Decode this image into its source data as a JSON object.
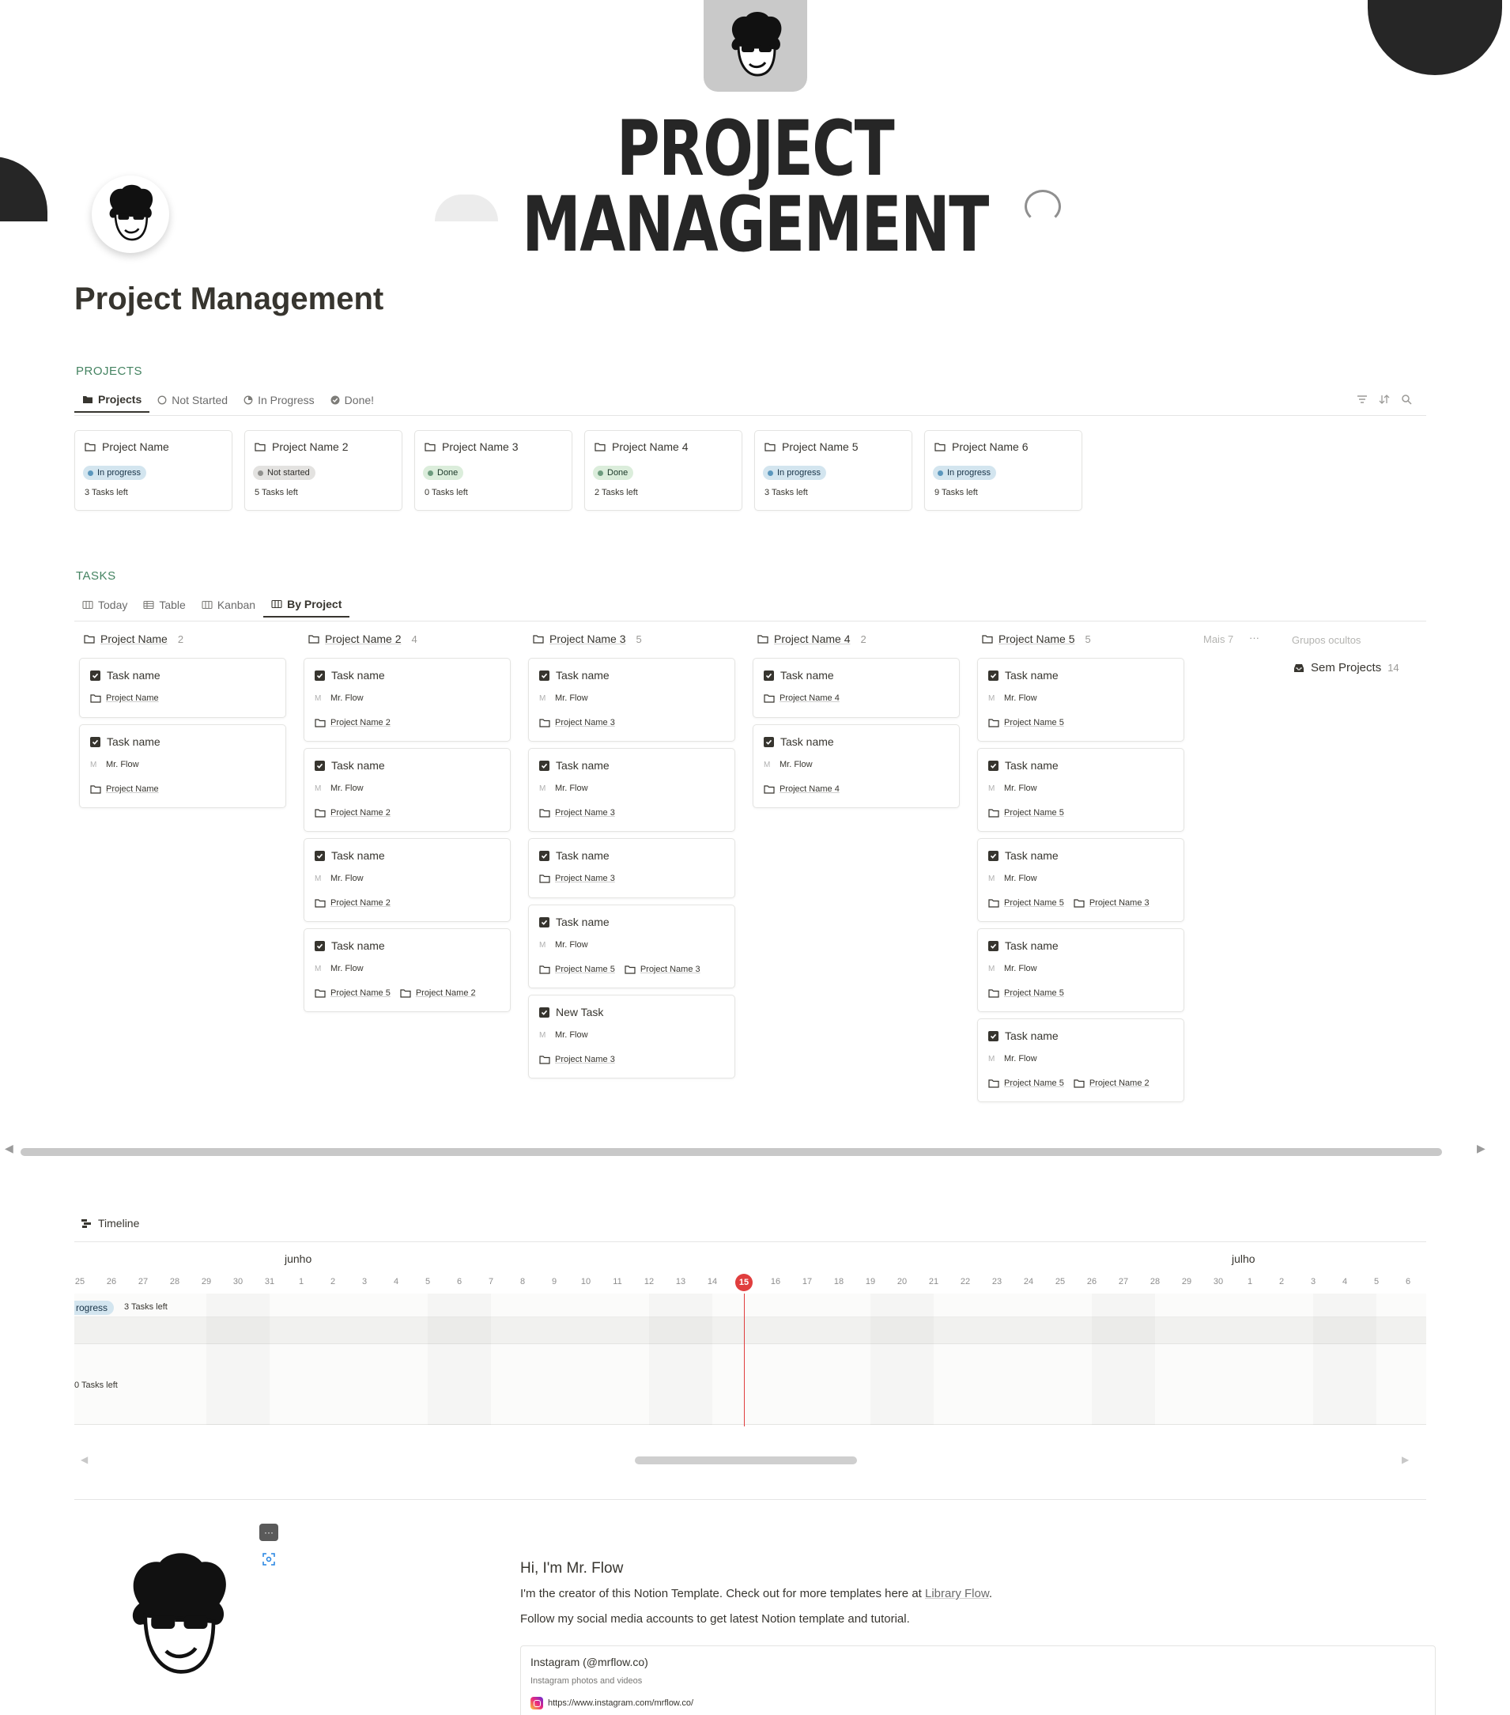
{
  "cover": {
    "title": "PROJECT MANAGEMENT"
  },
  "page": {
    "title": "Project Management"
  },
  "projects_section": {
    "label": "PROJECTS",
    "tabs": [
      {
        "label": "Projects",
        "icon": "folder-filled-icon",
        "active": true
      },
      {
        "label": "Not Started",
        "icon": "circle-empty-icon",
        "active": false
      },
      {
        "label": "In Progress",
        "icon": "circle-half-icon",
        "active": false
      },
      {
        "label": "Done!",
        "icon": "check-circle-icon",
        "active": false
      }
    ],
    "tools": [
      "filter-icon",
      "sort-icon",
      "search-icon"
    ],
    "cards": [
      {
        "name": "Project Name",
        "status": "In progress",
        "tasks": "3 Tasks left"
      },
      {
        "name": "Project Name 2",
        "status": "Not started",
        "tasks": "5 Tasks left"
      },
      {
        "name": "Project Name 3",
        "status": "Done",
        "tasks": "0 Tasks left"
      },
      {
        "name": "Project Name 4",
        "status": "Done",
        "tasks": "2 Tasks left"
      },
      {
        "name": "Project Name 5",
        "status": "In progress",
        "tasks": "3 Tasks left"
      },
      {
        "name": "Project Name 6",
        "status": "In progress",
        "tasks": "9 Tasks left"
      }
    ],
    "status_colors": {
      "In progress": {
        "bg": "#d3e5ef",
        "dot": "#5b97bd",
        "text": "#183347"
      },
      "Not started": {
        "bg": "#e3e2e0",
        "dot": "#91918e",
        "text": "#32302c"
      },
      "Done": {
        "bg": "#dbeddb",
        "dot": "#6c9b7d",
        "text": "#1c3829"
      }
    }
  },
  "tasks_section": {
    "label": "TASKS",
    "tabs": [
      {
        "label": "Today",
        "icon": "board-icon",
        "active": false
      },
      {
        "label": "Table",
        "icon": "table-icon",
        "active": false
      },
      {
        "label": "Kanban",
        "icon": "board-icon",
        "active": false
      },
      {
        "label": "By Project",
        "icon": "board-icon",
        "active": true
      }
    ],
    "columns": [
      {
        "name": "Project Name",
        "count": "2",
        "cards": [
          {
            "title": "Task name",
            "owner": "",
            "projects": [
              "Project Name"
            ]
          },
          {
            "title": "Task name",
            "owner": "Mr. Flow",
            "projects": [
              "Project Name"
            ]
          }
        ]
      },
      {
        "name": "Project Name 2",
        "count": "4",
        "cards": [
          {
            "title": "Task name",
            "owner": "Mr. Flow",
            "projects": [
              "Project Name 2"
            ]
          },
          {
            "title": "Task name",
            "owner": "Mr. Flow",
            "projects": [
              "Project Name 2"
            ]
          },
          {
            "title": "Task name",
            "owner": "Mr. Flow",
            "projects": [
              "Project Name 2"
            ]
          },
          {
            "title": "Task name",
            "owner": "Mr. Flow",
            "projects": [
              "Project Name 5",
              "Project Name 2"
            ]
          }
        ]
      },
      {
        "name": "Project Name 3",
        "count": "5",
        "cards": [
          {
            "title": "Task name",
            "owner": "Mr. Flow",
            "projects": [
              "Project Name 3"
            ]
          },
          {
            "title": "Task name",
            "owner": "Mr. Flow",
            "projects": [
              "Project Name 3"
            ]
          },
          {
            "title": "Task name",
            "owner": "",
            "projects": [
              "Project Name 3"
            ]
          },
          {
            "title": "Task name",
            "owner": "Mr. Flow",
            "projects": [
              "Project Name 5",
              "Project Name 3"
            ]
          },
          {
            "title": "New Task",
            "owner": "Mr. Flow",
            "projects": [
              "Project Name 3"
            ]
          }
        ]
      },
      {
        "name": "Project Name 4",
        "count": "2",
        "cards": [
          {
            "title": "Task name",
            "owner": "",
            "projects": [
              "Project Name 4"
            ]
          },
          {
            "title": "Task name",
            "owner": "Mr. Flow",
            "projects": [
              "Project Name 4"
            ]
          }
        ]
      },
      {
        "name": "Project Name 5",
        "count": "5",
        "cards": [
          {
            "title": "Task name",
            "owner": "Mr. Flow",
            "projects": [
              "Project Name 5"
            ]
          },
          {
            "title": "Task name",
            "owner": "Mr. Flow",
            "projects": [
              "Project Name 5"
            ]
          },
          {
            "title": "Task name",
            "owner": "Mr. Flow",
            "projects": [
              "Project Name 5",
              "Project Name 3"
            ]
          },
          {
            "title": "Task name",
            "owner": "Mr. Flow",
            "projects": [
              "Project Name 5"
            ]
          },
          {
            "title": "Task name",
            "owner": "Mr. Flow",
            "projects": [
              "Project Name 5",
              "Project Name 2"
            ]
          }
        ]
      }
    ],
    "more_label": "Mais 7",
    "more_menu": "···",
    "hidden_groups_label": "Grupos ocultos",
    "hidden_group": {
      "name": "Sem Projects",
      "count": "14",
      "icon": "inbox-icon"
    }
  },
  "timeline": {
    "title": "Timeline",
    "months": [
      "junho",
      "julho"
    ],
    "days": [
      "25",
      "26",
      "27",
      "28",
      "29",
      "30",
      "31",
      "1",
      "2",
      "3",
      "4",
      "5",
      "6",
      "7",
      "8",
      "9",
      "10",
      "11",
      "12",
      "13",
      "14",
      "15",
      "16",
      "17",
      "18",
      "19",
      "20",
      "21",
      "22",
      "23",
      "24",
      "25",
      "26",
      "27",
      "28",
      "29",
      "30",
      "1",
      "2",
      "3",
      "4",
      "5",
      "6"
    ],
    "today": "15",
    "today_color": "#e03e3e",
    "rows": [
      {
        "status": "rogress",
        "tasks": "3 Tasks left"
      },
      {
        "status": "",
        "tasks": "0 Tasks left"
      }
    ]
  },
  "bio": {
    "heading": "Hi, I'm Mr. Flow",
    "line1_prefix": "I'm the creator of this Notion Template. Check out for more templates here at ",
    "line1_link": "Library Flow",
    "line1_suffix": ".",
    "line2": "Follow my social media accounts to get latest Notion template and tutorial.",
    "bookmark": {
      "title": "Instagram (@mrflow.co)",
      "description": "Instagram photos and videos",
      "url": "https://www.instagram.com/mrflow.co/"
    },
    "more_button": "···"
  }
}
